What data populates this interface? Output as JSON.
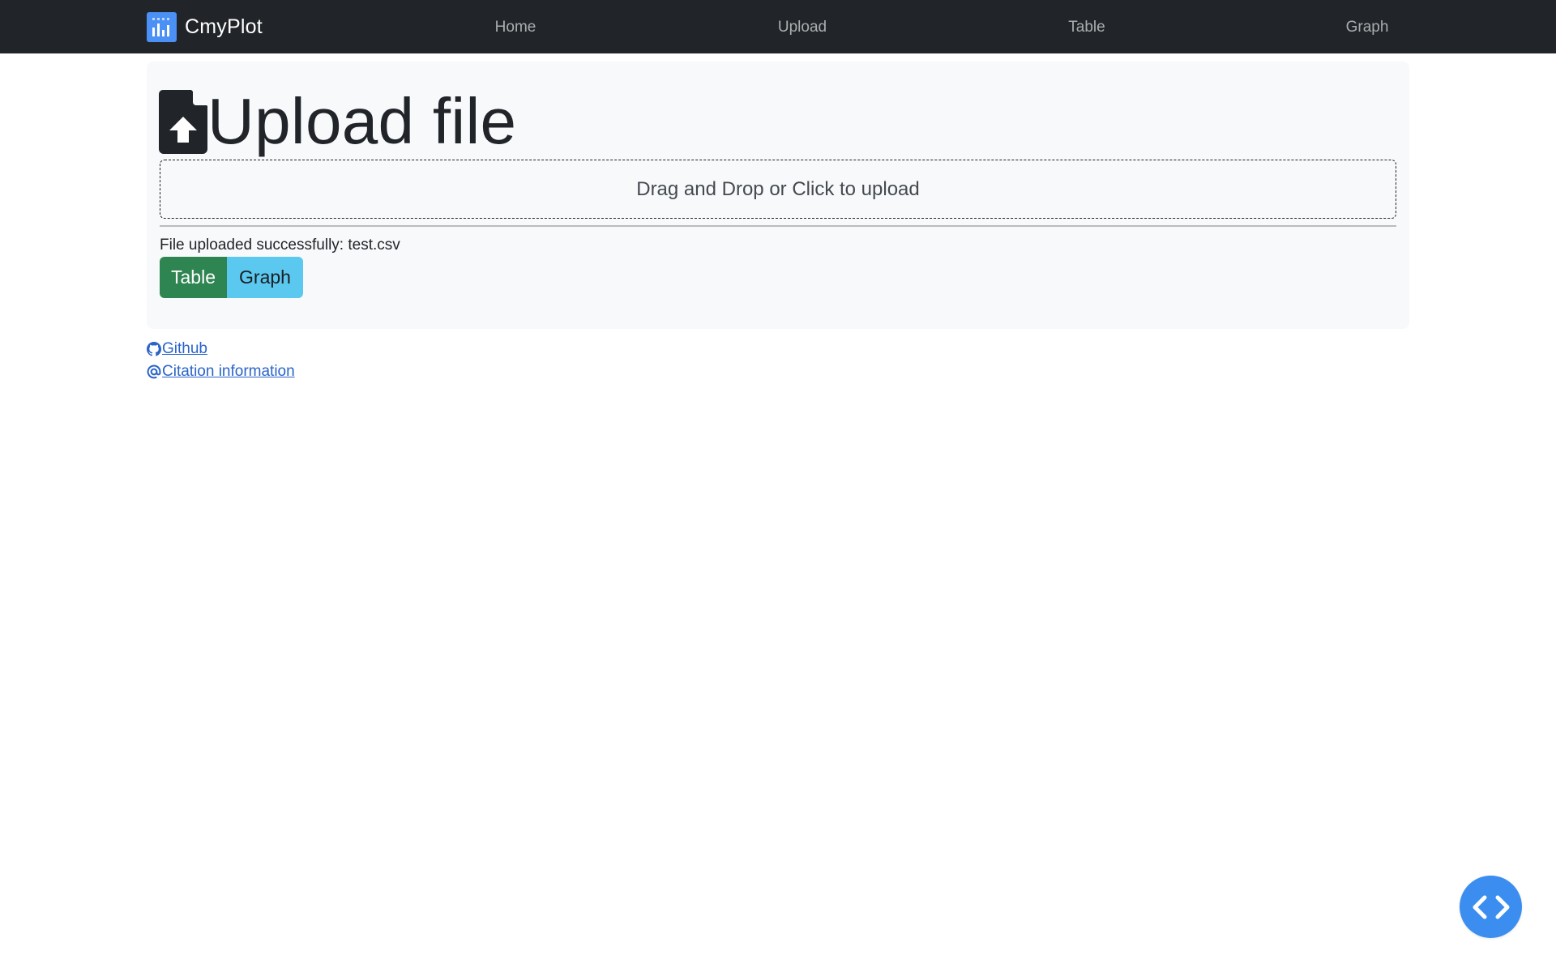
{
  "navbar": {
    "brand": "CmyPlot",
    "links": [
      "Home",
      "Upload",
      "Table",
      "Graph"
    ]
  },
  "page": {
    "title": "Upload file",
    "dropzone_text": "Drag and Drop or Click to upload",
    "status": "File uploaded successfully: test.csv",
    "buttons": {
      "table": "Table",
      "graph": "Graph"
    }
  },
  "footer": {
    "github": "Github",
    "citation": "Citation information"
  },
  "icons": {
    "brand": "bar-chart-icon",
    "title": "file-upload-icon",
    "github": "github-icon",
    "citation": "at-sign-icon",
    "fab": "code-icon"
  },
  "colors": {
    "navbar_bg": "#212529",
    "panel_bg": "#f8f9fa",
    "table_button": "#2f8551",
    "graph_button": "#5bc8f0",
    "link": "#2a64c9",
    "fab": "#3b8ef0",
    "brand_logo": "#4a90f5"
  }
}
